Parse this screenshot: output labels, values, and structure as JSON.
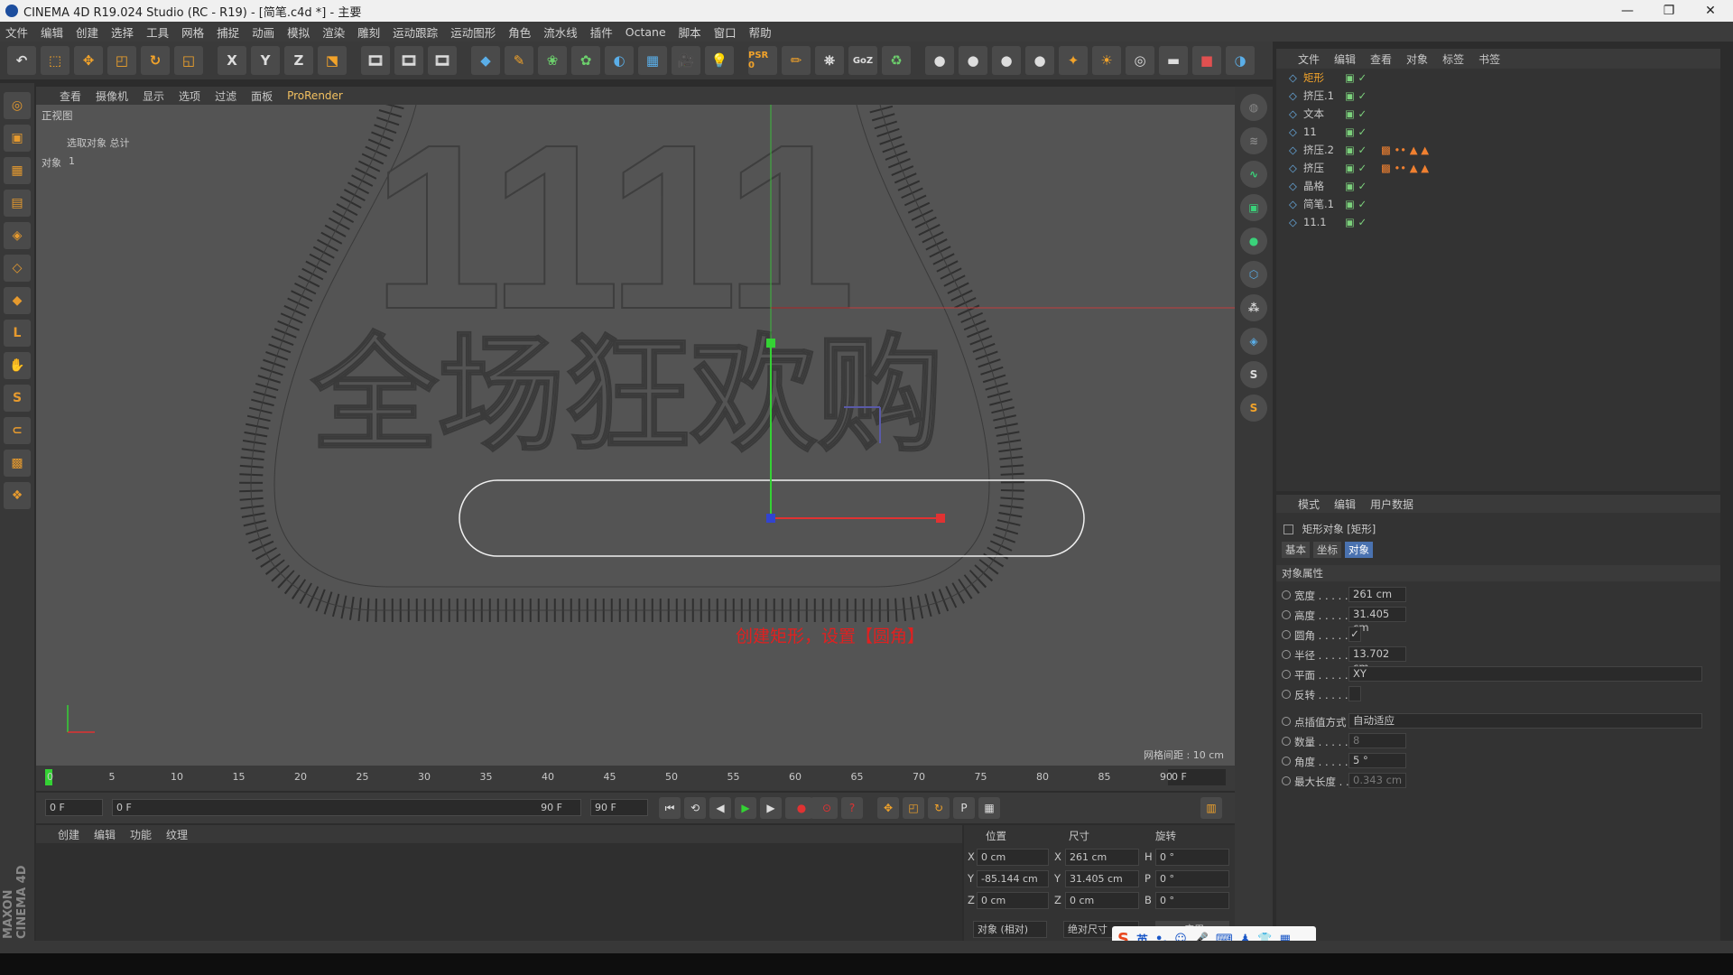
{
  "window": {
    "title": "CINEMA 4D R19.024 Studio (RC - R19) - [简笔.c4d *] - 主要",
    "minimize": "—",
    "restore": "❐",
    "close": "✕"
  },
  "menu": [
    "文件",
    "编辑",
    "创建",
    "选择",
    "工具",
    "网格",
    "捕捉",
    "动画",
    "模拟",
    "渲染",
    "雕刻",
    "运动跟踪",
    "运动图形",
    "角色",
    "流水线",
    "插件",
    "Octane",
    "脚本",
    "窗口",
    "帮助"
  ],
  "toolbar": {
    "items": [
      "↶",
      "⬚",
      "✥",
      "◰",
      "↻",
      "◱",
      "X",
      "Y",
      "Z",
      "⬔",
      "🎞",
      "🎞",
      "🎞",
      "◆",
      "✎",
      "❀",
      "✿",
      "◐",
      "▦",
      "🎥",
      "💡",
      "PSR 0",
      "✏",
      "⛯",
      "GoZ",
      "♻",
      "●",
      "●",
      "●",
      "●",
      "✦",
      "☀",
      "◎",
      "▬",
      "■",
      "◑"
    ]
  },
  "viewport": {
    "menu": [
      "查看",
      "摄像机",
      "显示",
      "选项",
      "过滤",
      "面板",
      "ProRender"
    ],
    "view_name": "正视图",
    "hud_line1": "选取对象 总计",
    "hud_line2_label": "对象",
    "hud_line2_value": "1",
    "grid_spacing": "网格间距 : 10 cm",
    "annotation": "创建矩形，设置【圆角】",
    "annotation_color": "#e02020",
    "title_text": "1111",
    "headline": "全场狂欢购"
  },
  "object_manager": {
    "menu": [
      "文件",
      "编辑",
      "查看",
      "对象",
      "标签",
      "书签"
    ],
    "rows": [
      {
        "name": "矩形",
        "selected": true
      },
      {
        "name": "挤压.1",
        "selected": false
      },
      {
        "name": "文本",
        "selected": false
      },
      {
        "name": "11",
        "selected": false
      },
      {
        "name": "挤压.2",
        "selected": false
      },
      {
        "name": "挤压",
        "selected": false
      },
      {
        "name": "晶格",
        "selected": false
      },
      {
        "name": "简笔.1",
        "selected": false
      },
      {
        "name": "11.1",
        "selected": false
      }
    ]
  },
  "attributes": {
    "menu": [
      "模式",
      "编辑",
      "用户数据"
    ],
    "header": "矩形对象 [矩形]",
    "tabs": [
      "基本",
      "坐标",
      "对象"
    ],
    "section": "对象属性",
    "fields": [
      {
        "label": "宽度 . . . . .",
        "value": "261 cm"
      },
      {
        "label": "高度 . . . . .",
        "value": "31.405 cm"
      },
      {
        "label": "圆角 . . . . .",
        "value": "✓"
      },
      {
        "label": "半径 . . . . .",
        "value": "13.702 cm"
      },
      {
        "label": "平面 . . . . .",
        "value": "XY"
      },
      {
        "label": "反转 . . . . .",
        "value": ""
      },
      {
        "label": "点插值方式",
        "value": "自动适应"
      },
      {
        "label": "数量 . . . . .",
        "value": "8"
      },
      {
        "label": "角度 . . . . .",
        "value": "5 °"
      },
      {
        "label": "最大长度 . .",
        "value": "0.343 cm"
      }
    ]
  },
  "timeline": {
    "ticks": [
      "0",
      "5",
      "10",
      "15",
      "20",
      "25",
      "30",
      "35",
      "40",
      "45",
      "50",
      "55",
      "60",
      "65",
      "70",
      "75",
      "80",
      "85",
      "90"
    ],
    "current": "0 F"
  },
  "playback": {
    "start": "0 F",
    "range_start": "0 F",
    "range_end": "90 F",
    "end": "90 F",
    "buttons": [
      "⏮",
      "⟲",
      "◀",
      "▶",
      "▶",
      "⟳",
      "⏭"
    ]
  },
  "material_panel": {
    "menu": [
      "创建",
      "编辑",
      "功能",
      "纹理"
    ]
  },
  "coords": {
    "headers": [
      "位置",
      "尺寸",
      "旋转"
    ],
    "rows": [
      {
        "axis": "X",
        "pos": "0 cm",
        "size_axis": "X",
        "size": "261 cm",
        "rot_axis": "H",
        "rot": "0 °"
      },
      {
        "axis": "Y",
        "pos": "-85.144 cm",
        "size_axis": "Y",
        "size": "31.405 cm",
        "rot_axis": "P",
        "rot": "0 °"
      },
      {
        "axis": "Z",
        "pos": "0 cm",
        "size_axis": "Z",
        "size": "0 cm",
        "rot_axis": "B",
        "rot": "0 °"
      }
    ],
    "mode": "对象 (相对)",
    "size_mode": "绝对尺寸",
    "apply": "应用"
  },
  "ime": {
    "lang": "英"
  },
  "brand": "MAXON CINEMA 4D"
}
